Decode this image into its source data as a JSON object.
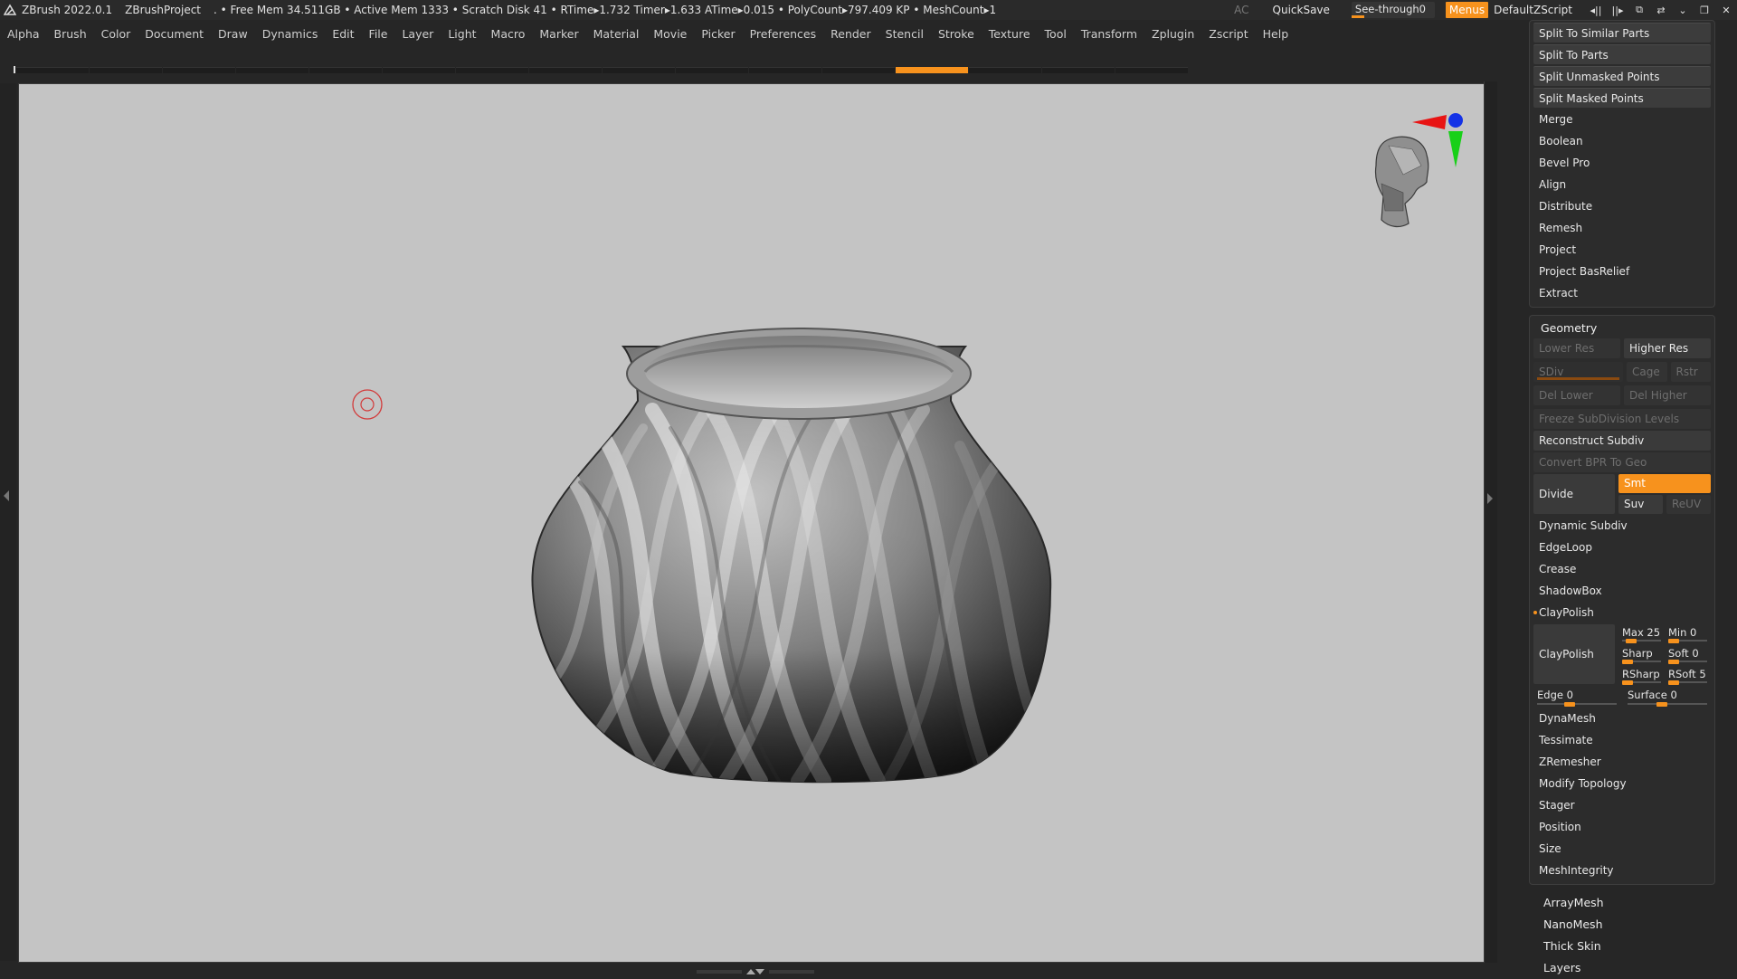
{
  "titlebar": {
    "app": "ZBrush 2022.0.1",
    "project": "ZBrushProject",
    "stats": ". • Free Mem 34.511GB • Active Mem 1333 • Scratch Disk 41 • RTime▸1.732 Timer▸1.633 ATime▸0.015 • PolyCount▸797.409 KP • MeshCount▸1",
    "ac": "AC",
    "quicksave": "QuickSave",
    "seethrough_label": "See-through",
    "seethrough_value": "0",
    "menus": "Menus",
    "default_script": "DefaultZScript",
    "accent_color": "#f7921d"
  },
  "menubar": [
    "Alpha",
    "Brush",
    "Color",
    "Document",
    "Draw",
    "Dynamics",
    "Edit",
    "File",
    "Layer",
    "Light",
    "Macro",
    "Marker",
    "Material",
    "Movie",
    "Picker",
    "Preferences",
    "Render",
    "Stencil",
    "Stroke",
    "Texture",
    "Tool",
    "Transform",
    "Zplugin",
    "Zscript",
    "Help"
  ],
  "tabstrip": {
    "count": 16,
    "active_index": 12
  },
  "viewport": {
    "background": "#c4c4c4",
    "model": "vase",
    "gizmo": [
      "head-icon",
      "x-axis-red",
      "y-axis-green",
      "z-axis-blue"
    ]
  },
  "subtool_actions": {
    "items": [
      "Split To Similar Parts",
      "Split To Parts",
      "Split Unmasked Points",
      "Split Masked Points",
      "Merge",
      "Boolean",
      "Bevel Pro",
      "Align",
      "Distribute",
      "Remesh",
      "Project",
      "Project BasRelief",
      "Extract"
    ]
  },
  "geometry": {
    "title": "Geometry",
    "lower_res": "Lower Res",
    "higher_res": "Higher Res",
    "sdiv": "SDiv",
    "cage": "Cage",
    "rstr": "Rstr",
    "del_lower": "Del Lower",
    "del_higher": "Del Higher",
    "freeze": "Freeze SubDivision Levels",
    "reconstruct": "Reconstruct Subdiv",
    "convert_bpr": "Convert BPR To Geo",
    "divide": "Divide",
    "smt": "Smt",
    "suv": "Suv",
    "reuv": "ReUV",
    "dynamic_subdiv": "Dynamic Subdiv",
    "edgeloop": "EdgeLoop",
    "crease": "Crease",
    "shadowbox": "ShadowBox",
    "claypolish_header": "ClayPolish",
    "claypolish_button": "ClayPolish",
    "cp_max": "Max 25",
    "cp_min": "Min 0",
    "cp_sharp": "Sharp",
    "cp_soft": "Soft 0",
    "cp_rsharp": "RSharp",
    "cp_rsoft": "RSoft 5",
    "cp_edge": "Edge 0",
    "cp_surface": "Surface 0",
    "after": [
      "DynaMesh",
      "Tessimate",
      "ZRemesher",
      "Modify Topology",
      "Stager",
      "Position",
      "Size",
      "MeshIntegrity"
    ]
  },
  "loose_items": [
    "ArrayMesh",
    "NanoMesh",
    "Thick Skin",
    "Layers"
  ]
}
